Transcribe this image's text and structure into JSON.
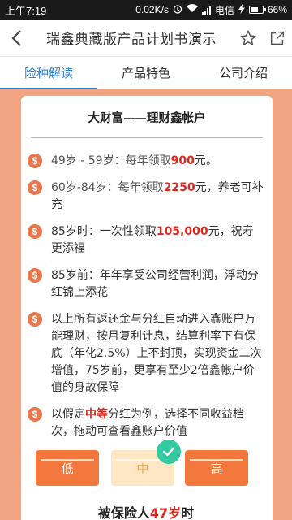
{
  "status_bar": {
    "time": "上午7:19",
    "speed": "0.02K/s",
    "carrier": "电信",
    "battery": "66%",
    "battery_level": 0.66
  },
  "app_bar": {
    "title": "瑞鑫典藏版产品计划书演示"
  },
  "tabs": [
    {
      "label": "险种解读",
      "active": true
    },
    {
      "label": "产品特色",
      "active": false
    },
    {
      "label": "公司介绍",
      "active": false
    }
  ],
  "card": {
    "title": "大财富——理财鑫帐户",
    "items": [
      {
        "pre": "49岁 - 59岁：每年领取",
        "highlight": "900",
        "post": "元。"
      },
      {
        "pre": "60岁-84岁：每年领取",
        "highlight": "2250",
        "post": "元，养老可补充"
      },
      {
        "pre": "85岁时：一次性领取",
        "highlight": "105,000",
        "post": "元，祝寿更添福"
      },
      {
        "pre": "85岁前：年年享受公司经营利润，浮动分红锦上添花",
        "highlight": "",
        "post": ""
      },
      {
        "pre": "以上所有返还金与分红自动进入鑫账户万能理财，按月复利计息，结算利率下有保底（年化2.5%）上不封顶，实现资金二次增值，75岁前，更享有至少2倍鑫帐户价值的身故保障",
        "highlight": "",
        "post": ""
      },
      {
        "pre": "以假定",
        "highlight": "中等",
        "post": "分红为例，选择不同收益档次，拖动可查看鑫账户价值"
      }
    ]
  },
  "levels": {
    "low": "低",
    "mid": "中",
    "high": "高",
    "selected": "mid"
  },
  "footer": {
    "pre": "被保险人",
    "age": "47岁",
    "post": "时"
  },
  "colors": {
    "accent": "#2f7fd6",
    "orange": "#f3783e",
    "background": "#f2a582",
    "red": "#e0261e",
    "check": "#33c9a1"
  }
}
